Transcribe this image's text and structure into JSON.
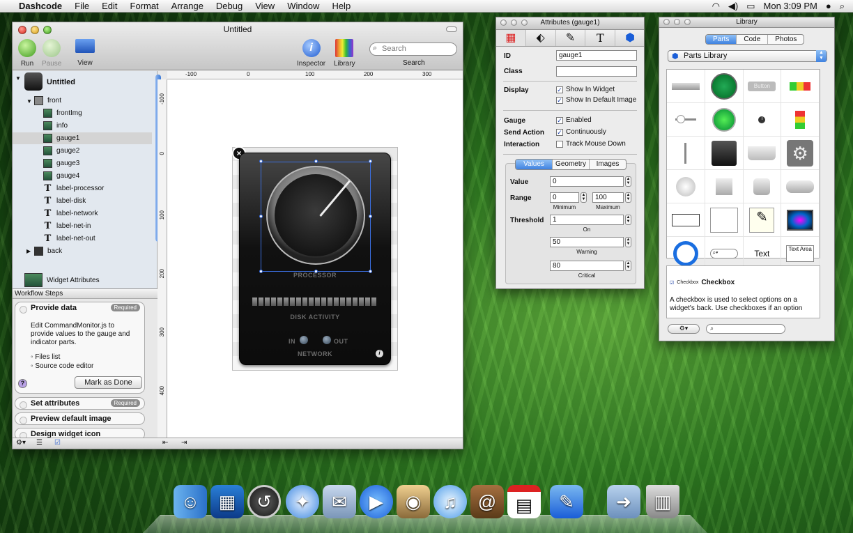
{
  "menubar": {
    "app": "Dashcode",
    "items": [
      "File",
      "Edit",
      "Format",
      "Arrange",
      "Debug",
      "View",
      "Window",
      "Help"
    ],
    "clock": "Mon 3:09 PM"
  },
  "main": {
    "title": "Untitled",
    "toolbar": {
      "run": "Run",
      "pause": "Pause",
      "view": "View",
      "inspector": "Inspector",
      "library": "Library",
      "search_placeholder": "Search",
      "search_label": "Search"
    },
    "tree": {
      "root": "Untitled",
      "front": "front",
      "items": [
        "frontImg",
        "info",
        "gauge1",
        "gauge2",
        "gauge3",
        "gauge4",
        "label-processor",
        "label-disk",
        "label-network",
        "label-net-in",
        "label-net-out"
      ],
      "back": "back",
      "widget_attributes": "Widget Attributes"
    },
    "workflow": {
      "header": "Workflow Steps",
      "step1_title": "Provide data",
      "required": "Required",
      "step1_desc": "Edit CommandMonitor.js to provide values to the gauge and indicator parts.",
      "link1": "Files list",
      "link2": "Source code editor",
      "mark_done": "Mark as Done",
      "step2": "Set attributes",
      "step3": "Preview default image",
      "step4": "Design widget icon"
    },
    "ruler_h": [
      "-100",
      "0",
      "100",
      "200",
      "300"
    ],
    "ruler_v": [
      "-100",
      "0",
      "100",
      "200",
      "300",
      "400"
    ],
    "widget": {
      "processor": "PROCESSOR",
      "disk": "DISK ACTIVITY",
      "in": "IN",
      "out": "OUT",
      "network": "NETWORK"
    }
  },
  "attrs": {
    "title": "Attributes (gauge1)",
    "id_label": "ID",
    "id_value": "gauge1",
    "class_label": "Class",
    "class_value": "",
    "display_label": "Display",
    "show_widget": "Show In Widget",
    "show_default": "Show In Default Image",
    "gauge_label": "Gauge",
    "enabled": "Enabled",
    "send_label": "Send Action",
    "continuously": "Continuously",
    "interaction_label": "Interaction",
    "track": "Track Mouse Down",
    "tabs": [
      "Values",
      "Geometry",
      "Images"
    ],
    "value_label": "Value",
    "value": "0",
    "range_label": "Range",
    "min": "0",
    "max": "100",
    "min_cap": "Minimum",
    "max_cap": "Maximum",
    "threshold_label": "Threshold",
    "on": "1",
    "on_cap": "On",
    "warning": "50",
    "warning_cap": "Warning",
    "critical": "80",
    "critical_cap": "Critical"
  },
  "library": {
    "title": "Library",
    "tabs": [
      "Parts",
      "Code",
      "Photos"
    ],
    "popup": "Parts Library",
    "button_cell": "Button",
    "text_cell": "Text",
    "textarea_cell": "Text Area",
    "desc_title": "Checkbox",
    "desc_small": "Checkbox",
    "desc": "A checkbox is used to select options on a widget's back. Use checkboxes if an option"
  },
  "colors": {
    "accent": "#3f82e0",
    "desktop": "#2f7d22"
  }
}
